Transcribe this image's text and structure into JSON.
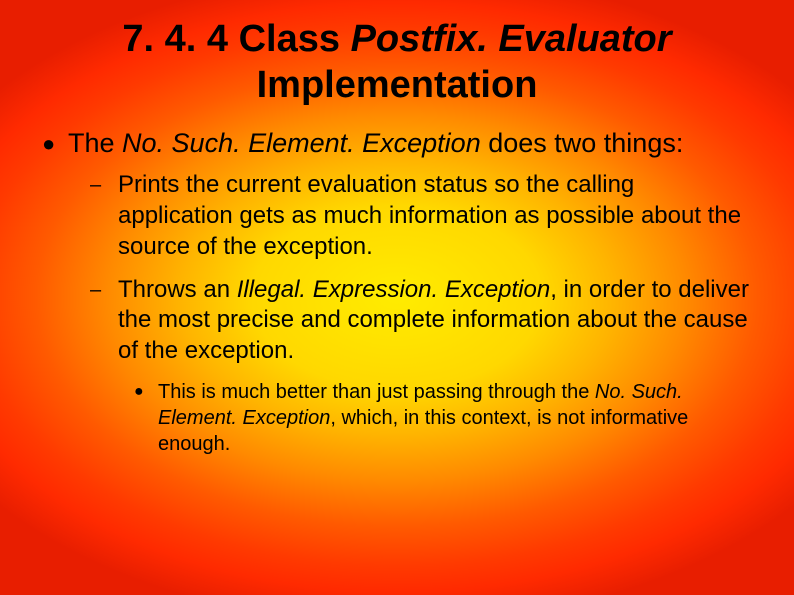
{
  "title": {
    "prefix": "7. 4. 4 Class ",
    "italic": "Postfix. Evaluator",
    "suffix1": " Implementation"
  },
  "lvl1": {
    "pre": "The ",
    "italic": "No. Such. Element. Exception",
    "post": " does two things:"
  },
  "lvl2a": "Prints the current evaluation status so the calling application gets as much information as possible about the source of the exception.",
  "lvl2b": {
    "pre": "Throws an ",
    "italic": "Illegal. Expression. Exception",
    "post": ", in order to deliver the most precise and complete information about the cause of the exception."
  },
  "lvl3": {
    "pre": "This is much better than just passing through the ",
    "italic": "No. Such. Element. Exception",
    "post": ", which, in this context, is not informative enough."
  }
}
